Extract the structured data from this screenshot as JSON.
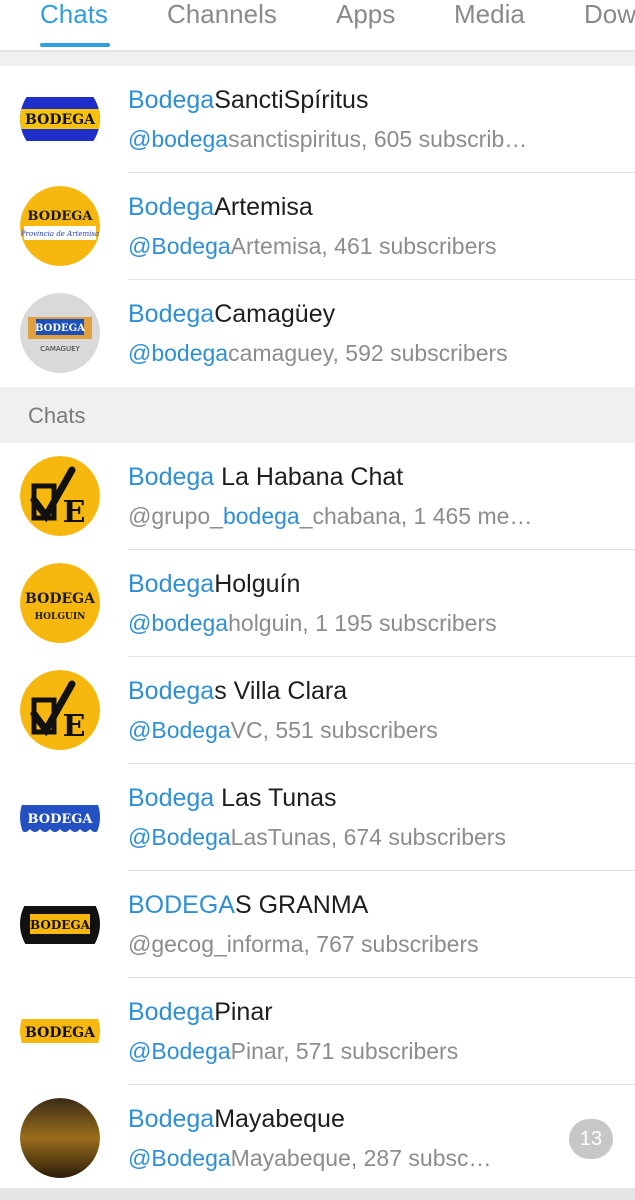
{
  "tabs": [
    {
      "label": "Chats",
      "active": true
    },
    {
      "label": "Channels",
      "active": false
    },
    {
      "label": "Apps",
      "active": false
    },
    {
      "label": "Media",
      "active": false
    },
    {
      "label": "Dow",
      "active": false
    }
  ],
  "channels": [
    {
      "title_hl": "Bodega",
      "title_rest": "SanctiSpíritus",
      "sub_hl": "@bodega",
      "sub_rest": "sanctispiritus, 605 subscrib…",
      "icon": "bodega-blue-logo"
    },
    {
      "title_hl": "Bodega",
      "title_rest": "Artemisa",
      "sub_hl": "@Bodega",
      "sub_rest": "Artemisa, 461 subscribers",
      "icon": "bodega-artemisa-logo"
    },
    {
      "title_hl": "Bodega",
      "title_rest": "Camagüey",
      "sub_hl": "@bodega",
      "sub_rest": "camaguey, 592 subscribers",
      "icon": "bodega-camaguey-logo"
    }
  ],
  "section_header": "Chats",
  "chats": [
    {
      "title_hl": "Bodega",
      "title_rest": " La Habana Chat",
      "sub_pre": "@grupo_",
      "sub_hl": "bodega",
      "sub_rest": "_chabana, 1 465 me…",
      "icon": "check-e-logo"
    },
    {
      "title_hl": "Bodega",
      "title_rest": "Holguín",
      "sub_hl": "@bodega",
      "sub_rest": "holguin, 1 195 subscribers",
      "icon": "bodega-holguin-logo"
    },
    {
      "title_hl": "Bodega",
      "title_rest": "s Villa Clara",
      "sub_hl": "@Bodega",
      "sub_rest": "VC, 551 subscribers",
      "icon": "check-e-logo"
    },
    {
      "title_hl": "Bodega",
      "title_rest": " Las Tunas",
      "sub_hl": "@Bodega",
      "sub_rest": "LasTunas, 674 subscribers",
      "icon": "bodega-lastunas-logo"
    },
    {
      "title_hl": "BODEGA",
      "title_rest": "S GRANMA",
      "sub_hl": "",
      "sub_rest": "@gecog_informa, 767 subscribers",
      "icon": "bodega-granma-logo"
    },
    {
      "title_hl": "Bodega",
      "title_rest": "Pinar",
      "sub_hl": "@Bodega",
      "sub_rest": "Pinar, 571 subscribers",
      "icon": "bodega-pinar-logo"
    },
    {
      "title_hl": "Bodega",
      "title_rest": "Mayabeque",
      "sub_hl": "@Bodega",
      "sub_rest": "Mayabeque, 287 subsc…",
      "icon": "photo-avatar",
      "badge": "13"
    }
  ],
  "logo_text": {
    "bodega": "BODEGA",
    "artemisa_caption": "Provincia de Artemisa",
    "camaguey_caption": "CAMAGUEY",
    "holguin_caption": "HOLGUIN",
    "e_letter": "E"
  },
  "colors": {
    "accent": "#2f9fe0",
    "link": "#2f8fd6",
    "logo_yellow": "#f6b80e",
    "logo_blue": "#1d3fbf"
  }
}
